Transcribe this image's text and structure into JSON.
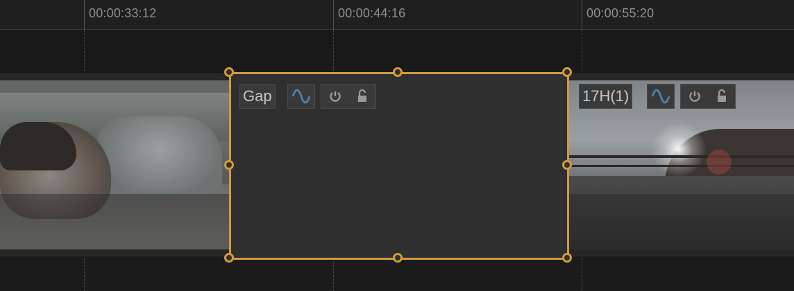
{
  "ruler": {
    "timecodes": [
      "00:00:33:12",
      "00:00:44:16",
      "00:00:55:20"
    ]
  },
  "clips": {
    "gap": {
      "name": "Gap"
    },
    "right": {
      "name": "17H(1)"
    }
  },
  "icons": {
    "audio": "audio-wave-icon",
    "power": "power-icon",
    "lock": "unlock-icon"
  },
  "colors": {
    "selection": "#d39a3f",
    "wave": "#4f7fa6"
  }
}
